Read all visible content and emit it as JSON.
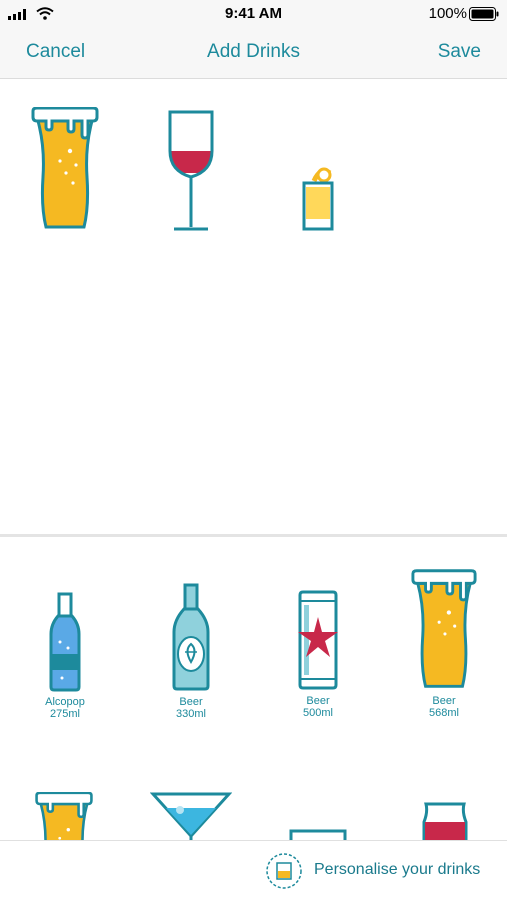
{
  "status_bar": {
    "time": "9:41 AM",
    "battery": "100%"
  },
  "nav": {
    "cancel_label": "Cancel",
    "title": "Add Drinks",
    "save_label": "Save"
  },
  "selected_drinks": [
    {
      "icon": "pint-glass-icon"
    },
    {
      "icon": "wine-glass-icon"
    },
    {
      "icon": "shot-glass-icon"
    }
  ],
  "catalog": [
    {
      "icon": "alcopop-bottle-icon",
      "label": "Alcopop",
      "size": "275ml"
    },
    {
      "icon": "beer-bottle-icon",
      "label": "Beer",
      "size": "330ml"
    },
    {
      "icon": "beer-can-icon",
      "label": "Beer",
      "size": "500ml"
    },
    {
      "icon": "beer-pint-glass-icon",
      "label": "Beer",
      "size": "568ml"
    }
  ],
  "bottom": {
    "personalise_label": "Personalise your drinks"
  },
  "colors": {
    "accent": "#1d8a9c",
    "beer": "#f5b922",
    "wine": "#c8284a",
    "alcopop": "#5aa9e6"
  }
}
